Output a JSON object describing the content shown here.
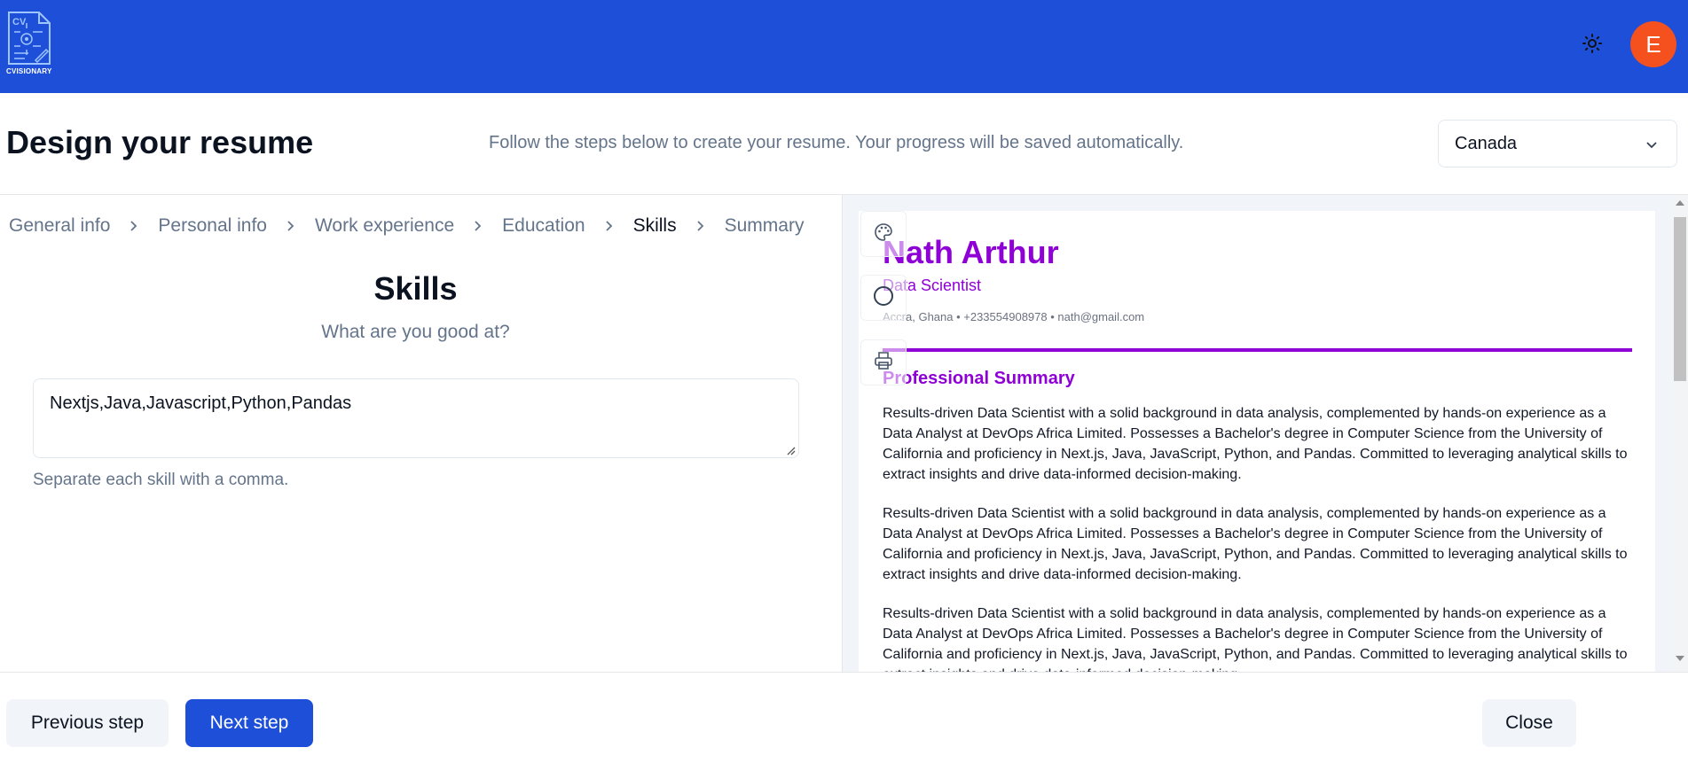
{
  "header": {
    "logo_text": "CVISIONARY",
    "theme_icon": "sun-icon",
    "avatar_initial": "E",
    "colors": {
      "bar": "#1e4fd8",
      "avatar": "#f4511e"
    }
  },
  "page": {
    "title": "Design your resume",
    "subtitle": "Follow the steps below to create your resume. Your progress will be saved automatically.",
    "country": "Canada"
  },
  "breadcrumb": {
    "steps": [
      "General info",
      "Personal info",
      "Work experience",
      "Education",
      "Skills",
      "Summary"
    ],
    "active": "Skills"
  },
  "form": {
    "title": "Skills",
    "subtitle": "What are you good at?",
    "skills_value": "Nextjs,Java,Javascript,Python,Pandas",
    "hint": "Separate each skill with a comma."
  },
  "preview": {
    "accent": "#8f00d6",
    "tools": [
      "palette-icon",
      "circle-icon",
      "printer-icon"
    ],
    "name": "Nath Arthur",
    "role": "Data Scientist",
    "contact": "Accra, Ghana • +233554908978 • nath@gmail.com",
    "section_title": "Professional Summary",
    "paragraphs": [
      "Results-driven Data Scientist with a solid background in data analysis, complemented by hands-on experience as a Data Analyst at DevOps Africa Limited. Possesses a Bachelor's degree in Computer Science from the University of California and proficiency in Next.js, Java, JavaScript, Python, and Pandas. Committed to leveraging analytical skills to extract insights and drive data-informed decision-making.",
      "Results-driven Data Scientist with a solid background in data analysis, complemented by hands-on experience as a Data Analyst at DevOps Africa Limited. Possesses a Bachelor's degree in Computer Science from the University of California and proficiency in Next.js, Java, JavaScript, Python, and Pandas. Committed to leveraging analytical skills to extract insights and drive data-informed decision-making.",
      "Results-driven Data Scientist with a solid background in data analysis, complemented by hands-on experience as a Data Analyst at DevOps Africa Limited. Possesses a Bachelor's degree in Computer Science from the University of California and proficiency in Next.js, Java, JavaScript, Python, and Pandas. Committed to leveraging analytical skills to extract insights and drive data-informed decision-making."
    ]
  },
  "footer": {
    "prev_label": "Previous step",
    "next_label": "Next step",
    "close_label": "Close"
  }
}
